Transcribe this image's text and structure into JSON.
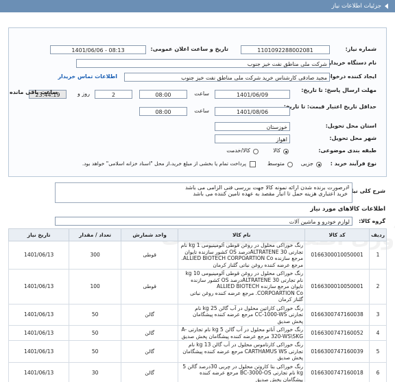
{
  "header": {
    "title": "جزئیات اطلاعات نیاز"
  },
  "fields": {
    "need_number_label": "شماره نیاز:",
    "need_number": "1101092288002081",
    "announce_label": "تاریخ و ساعت اعلان عمومی:",
    "announce_value": "1401/06/06 - 08:13",
    "buyer_org_label": "نام دستگاه خریدار:",
    "buyer_org": "شرکت ملی مناطق نفت خیز جنوب",
    "creator_label": "ایجاد کننده درخواست:",
    "creator": "مجید صادقی  کارشناس خرید  شرکت ملی مناطق نفت خیز جنوب",
    "contact_link": "اطلاعات تماس خریدار",
    "deadline_label": "مهلت ارسال پاسخ: تا تاریخ:",
    "deadline_date": "1401/06/09",
    "time_label": "ساعت",
    "deadline_time": "08:00",
    "day_label": "روز و",
    "days": "2",
    "remaining_time": "23:44:19",
    "remaining_label": "ساعت باقی مانده",
    "min_price_label": "حداقل تاریخ اعتبار قیمت: تا تاریخ:",
    "price_date": "1401/08/06",
    "price_time_label": "ساعت",
    "price_time": "08:00",
    "province_label": "استان محل تحویل:",
    "province": "خوزستان",
    "city_label": "شهر محل تحویل:",
    "city": "اهواز",
    "category_label": "طبقه بندی موضوعی:",
    "cat_goods": "کالا",
    "cat_goods_service": "کالا/خدمت",
    "purchase_type_label": "نوع فرآیند خرید :",
    "pt_partial": "جزیی",
    "pt_medium": "متوسط",
    "payment_note": "پرداخت تمام یا بخشی از مبلغ خرید،از محل \"اسناد خزانه اسلامی\" خواهد بود."
  },
  "description": {
    "label": "شرح کلی نیاز:",
    "lines": [
      "درصورت برنده شدن ارائه نمونه کالا جهت بررسی فنی الزامی می باشد",
      "خرید اعتباری هزینه حمل تا انبار مقصد به عهده تامین کننده می باشد"
    ]
  },
  "goods_title": "اطلاعات کالاهای مورد نیاز",
  "group_label": "گروه کالا:",
  "group_value": "لوازم خودرو و ماشین آلات",
  "watermark": "مرکز فراهم آوری اطلاعات مناقصات",
  "table": {
    "headers": [
      "ردیف",
      "کد کالا",
      "نام کالا",
      "واحد شمارش",
      "تعداد / مقدار",
      "تاریخ نیاز"
    ],
    "rows": [
      {
        "n": "1",
        "code": "0166300010050001",
        "name": "رنگ خوراکی محلول در روغن قوطی آلومینیومی 1 kg نام تجارتی ALTRATENE 30درصد OS کشور سازنده تایوان مرجع سازنده ALLIED BIOTECH CORPOARTION Co. مرجع عرضه کننده روغن نباتی گلناز کرمان",
        "unit": "قوطی",
        "qty": "300",
        "date": "1401/06/13"
      },
      {
        "n": "2",
        "code": "0166300010050001",
        "name": "رنگ خوراکی محلول در روغن قوطی آلومینیومی 10 kg نام تجارتی ALTRATENE 30درصد OS کشور سازنده تایوان مرجع سازنده ALLIED BIOTECH CORPOARTION Co. مرجع عرضه کننده روغن نباتی گلناز کرمان",
        "unit": "قوطی",
        "qty": "100",
        "date": "1401/06/13"
      },
      {
        "n": "3",
        "code": "0166300747160038",
        "name": "رنگ خوراکی کاراتین محلول در آب گالن 25 kg نام تجارتی CC-1000-WS مرجع عرضه کننده پیشگامان پخش صدیق",
        "unit": "گالن",
        "qty": "50",
        "date": "1401/06/13"
      },
      {
        "n": "4",
        "code": "0166300747160052",
        "name": "رنگ خوراکی آناتو محلول در آب گالن 5 kg نام تجارتی A-320-WS\\SKG مرجع عرضه کننده پیشگامان پخش صدیق",
        "unit": "گالن",
        "qty": "50",
        "date": "1401/06/13"
      },
      {
        "n": "5",
        "code": "0166300747160039",
        "name": "رنگ خوراکی کارتاموس محلول در آب گالن 13 kg نام تجارتی CARTHAMUS WS مرجع عرضه کننده پیشگامان پخش صدیق",
        "unit": "گالن",
        "qty": "50",
        "date": "1401/06/13"
      },
      {
        "n": "6",
        "code": "0166300747160018",
        "name": "رنگ خوراکی بتا کاروتن محلول در چربی 30درصد گالن 5 kg نام تجارتی BC-3000-OS مرجع عرضه کننده پیشگامان پخش صدیق",
        "unit": "گالن",
        "qty": "30",
        "date": "1401/06/13"
      }
    ]
  }
}
